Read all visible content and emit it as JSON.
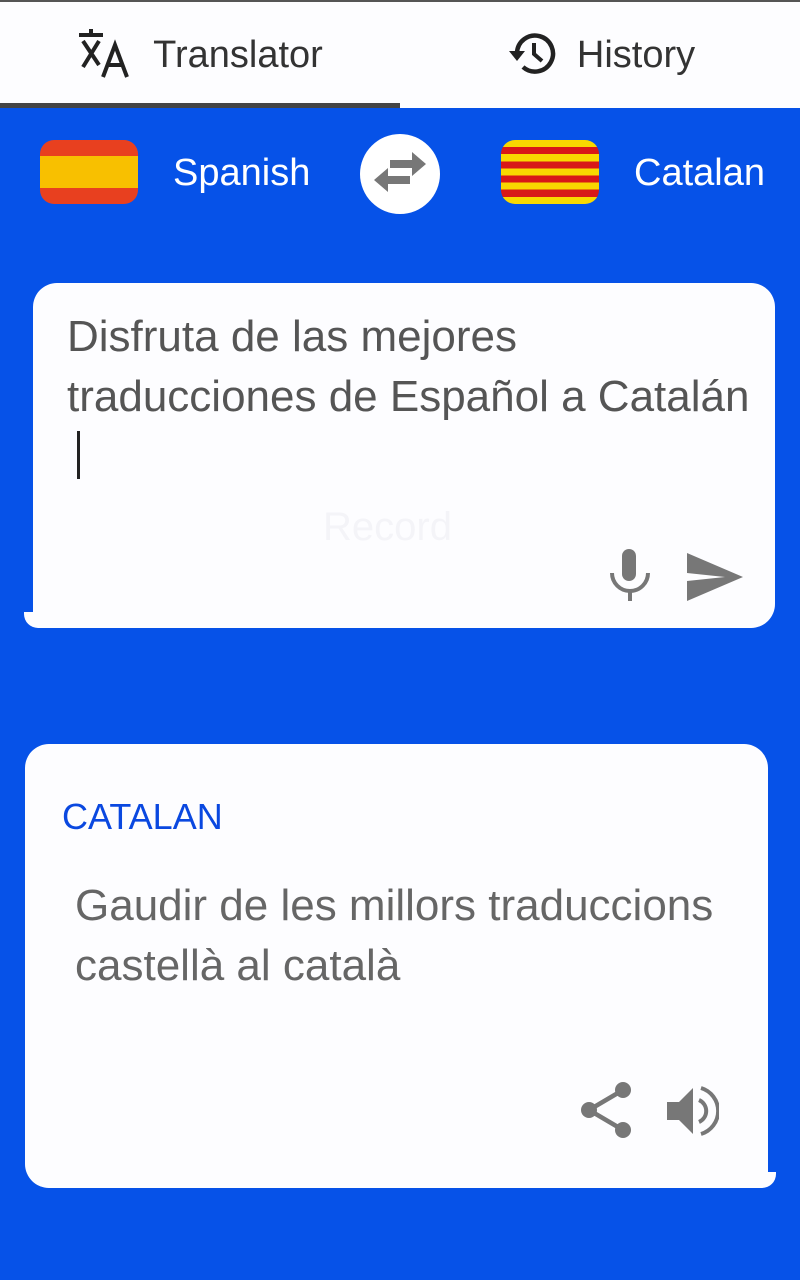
{
  "tabs": [
    {
      "label": "Translator",
      "icon": "translate-icon",
      "active": true
    },
    {
      "label": "History",
      "icon": "history-icon",
      "active": false
    }
  ],
  "languages": {
    "source": {
      "label": "Spanish",
      "flag": "spain-flag"
    },
    "target": {
      "label": "Catalan",
      "flag": "catalonia-flag"
    },
    "swap_icon": "swap-icon"
  },
  "input": {
    "value": "Disfruta de las mejores traducciones de Español a Catalán",
    "watermark": "Record"
  },
  "output": {
    "language_label": "CATALAN",
    "text": "Gaudir de les millors traduccions castellà al català"
  },
  "colors": {
    "background": "#0652e8",
    "accent": "#0a48e0",
    "icon_gray": "#777777"
  }
}
